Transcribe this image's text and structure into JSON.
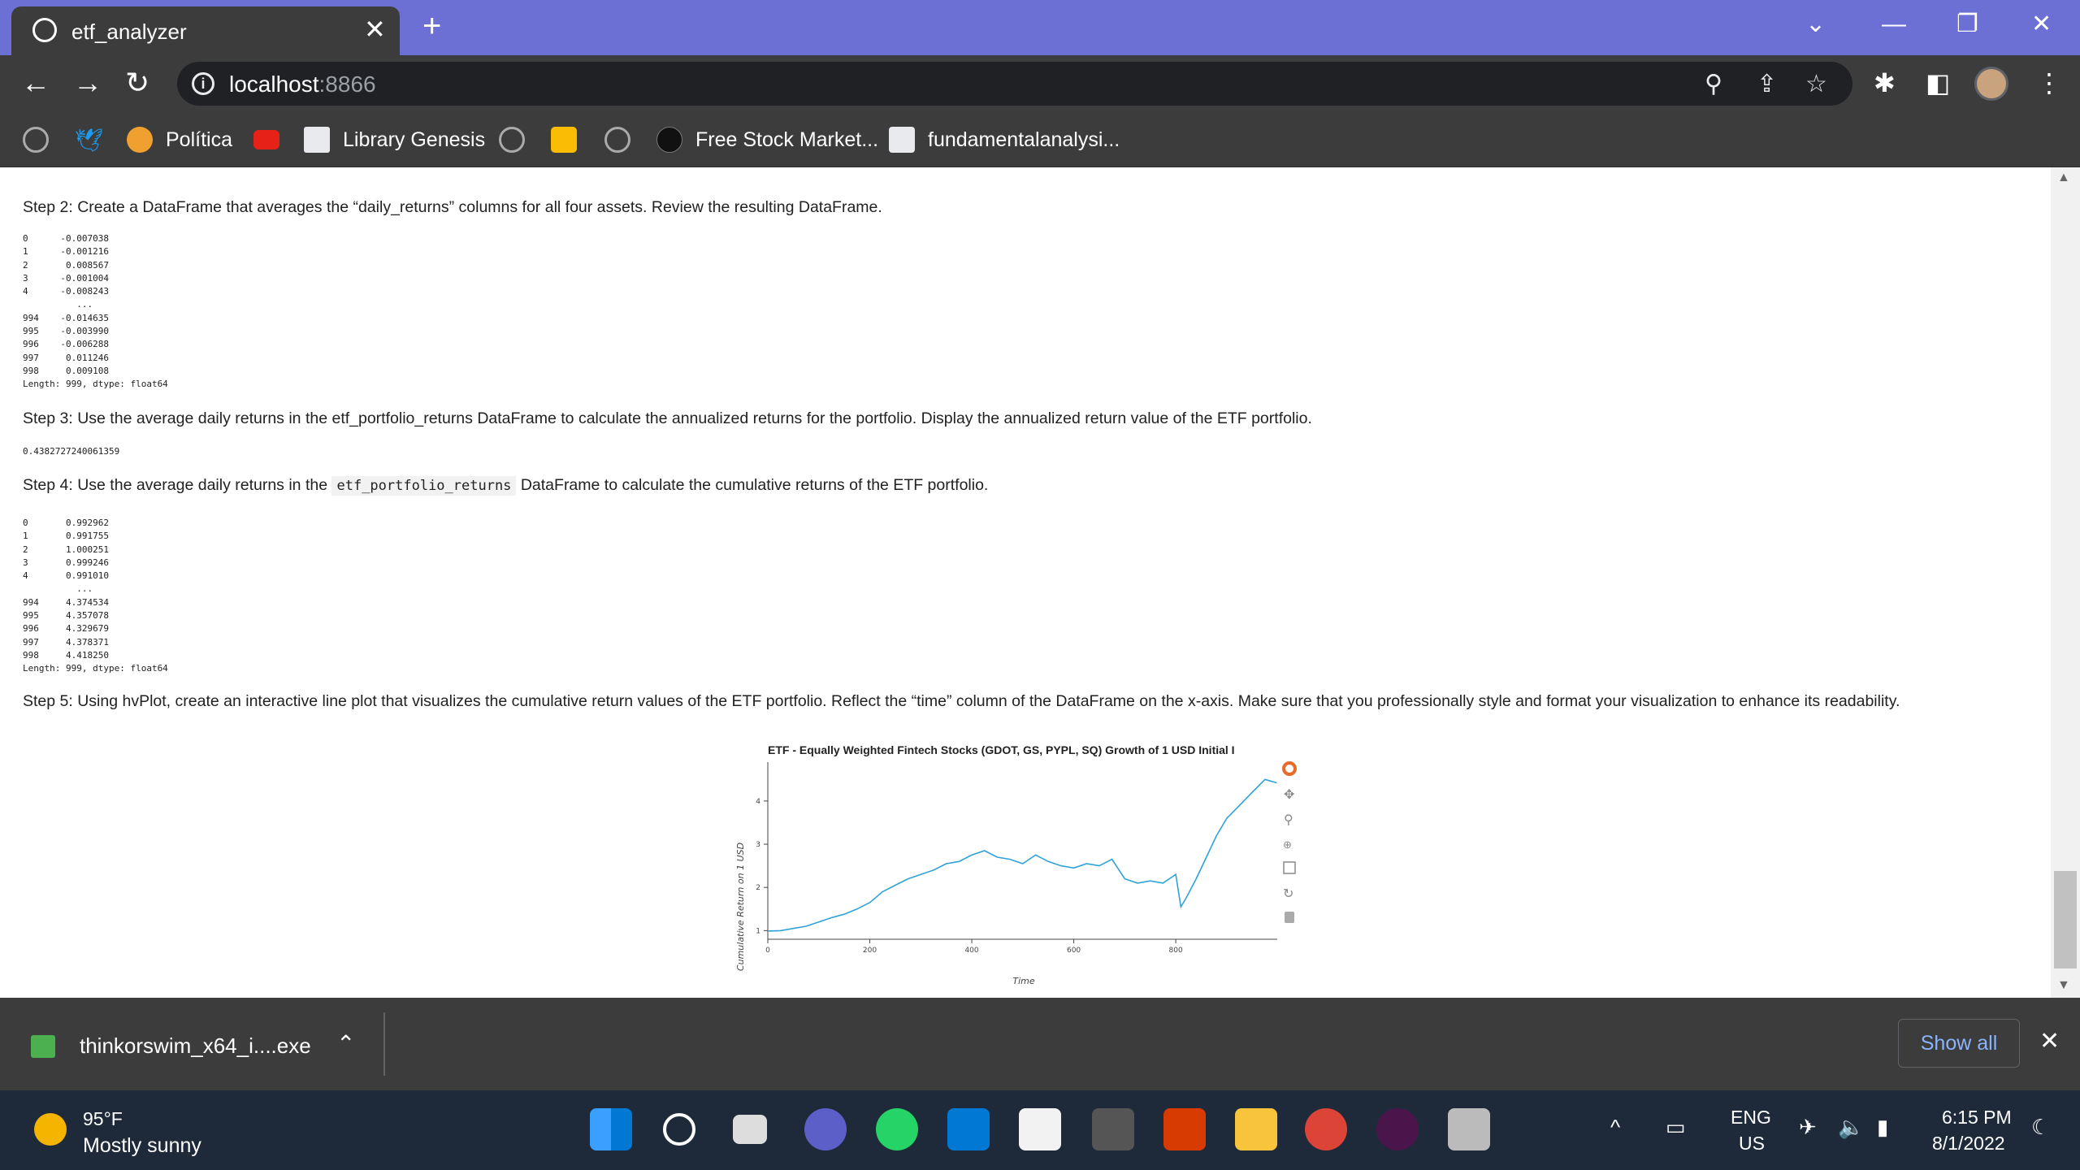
{
  "browser": {
    "tab_title": "etf_analyzer",
    "url_host": "localhost",
    "url_port": ":8866"
  },
  "bookmarks": [
    {
      "label": ""
    },
    {
      "label": ""
    },
    {
      "label": "Política"
    },
    {
      "label": ""
    },
    {
      "label": "Library Genesis"
    },
    {
      "label": ""
    },
    {
      "label": ""
    },
    {
      "label": ""
    },
    {
      "label": "Free Stock Market..."
    },
    {
      "label": "fundamentalanalysi..."
    }
  ],
  "notebook": {
    "step2": "Step 2: Create a DataFrame that averages the “daily_returns” columns for all four assets. Review the resulting DataFrame.",
    "step2_output": "0      -0.007038\n1      -0.001216\n2       0.008567\n3      -0.001004\n4      -0.008243\n          ...\n994    -0.014635\n995    -0.003990\n996    -0.006288\n997     0.011246\n998     0.009108\nLength: 999, dtype: float64",
    "step3": "Step 3: Use the average daily returns in the etf_portfolio_returns DataFrame to calculate the annualized returns for the portfolio. Display the annualized return value of the ETF portfolio.",
    "step3_output": "0.4382727240061359",
    "step4_pre": "Step 4: Use the average daily returns in the ",
    "step4_code": "etf_portfolio_returns",
    "step4_post": " DataFrame to calculate the cumulative returns of the ETF portfolio.",
    "step4_output": "0       0.992962\n1       0.991755\n2       1.000251\n3       0.999246\n4       0.991010\n          ...\n994     4.374534\n995     4.357078\n996     4.329679\n997     4.378371\n998     4.418250\nLength: 999, dtype: float64",
    "step5": "Step 5: Using hvPlot, create an interactive line plot that visualizes the cumulative return values of the ETF portfolio. Reflect the “time” column of the DataFrame on the x-axis. Make sure that you professionally style and format your visualization to enhance its readability."
  },
  "chart_data": {
    "type": "line",
    "title": "ETF - Equally Weighted Fintech Stocks (GDOT, GS, PYPL, SQ) Growth of 1 USD Initial I",
    "xlabel": "Time",
    "ylabel": "Cumulative Return on 1 USD",
    "xlim": [
      0,
      999
    ],
    "ylim": [
      0.8,
      4.9
    ],
    "x_ticks": [
      "0",
      "200",
      "400",
      "600",
      "800"
    ],
    "y_ticks": [
      "1",
      "2",
      "3",
      "4"
    ],
    "series": [
      {
        "color": "#30a2da",
        "x": [
          0,
          25,
          50,
          75,
          100,
          125,
          150,
          175,
          200,
          225,
          250,
          275,
          300,
          325,
          350,
          375,
          400,
          425,
          450,
          475,
          500,
          525,
          550,
          575,
          600,
          625,
          650,
          675,
          700,
          725,
          750,
          775,
          800,
          810,
          820,
          840,
          860,
          880,
          900,
          925,
          950,
          975,
          998
        ],
        "y": [
          0.99,
          1.0,
          1.05,
          1.1,
          1.2,
          1.3,
          1.38,
          1.5,
          1.65,
          1.9,
          2.05,
          2.2,
          2.3,
          2.4,
          2.55,
          2.6,
          2.75,
          2.85,
          2.7,
          2.65,
          2.55,
          2.75,
          2.6,
          2.5,
          2.45,
          2.55,
          2.5,
          2.65,
          2.2,
          2.1,
          2.15,
          2.1,
          2.3,
          1.55,
          1.75,
          2.2,
          2.7,
          3.2,
          3.6,
          3.9,
          4.2,
          4.5,
          4.42
        ]
      }
    ]
  },
  "downloads": {
    "file": "thinkorswim_x64_i....exe",
    "show_all": "Show all"
  },
  "taskbar": {
    "temp": "95°F",
    "weather": "Mostly sunny",
    "lang1": "ENG",
    "lang2": "US",
    "time": "6:15 PM",
    "date": "8/1/2022"
  }
}
